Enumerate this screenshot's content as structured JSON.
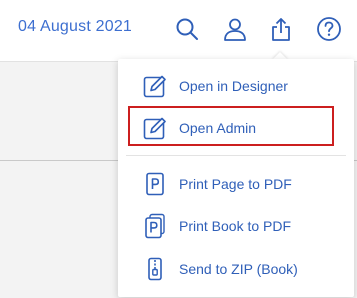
{
  "header": {
    "date": "04 August 2021",
    "icons": [
      "search-icon",
      "user-icon",
      "share-icon",
      "help-icon"
    ]
  },
  "menu": {
    "items": [
      {
        "label": "Open in Designer",
        "icon": "edit-icon"
      },
      {
        "label": "Open Admin",
        "icon": "edit-icon",
        "highlighted": true
      },
      {
        "label": "Print Page to PDF",
        "icon": "pdf-page-icon"
      },
      {
        "label": "Print Book to PDF",
        "icon": "pdf-book-icon"
      },
      {
        "label": "Send to ZIP (Book)",
        "icon": "zip-icon"
      }
    ]
  },
  "colors": {
    "accent": "#3d6fd0",
    "highlight_border": "#cc1f1f"
  }
}
